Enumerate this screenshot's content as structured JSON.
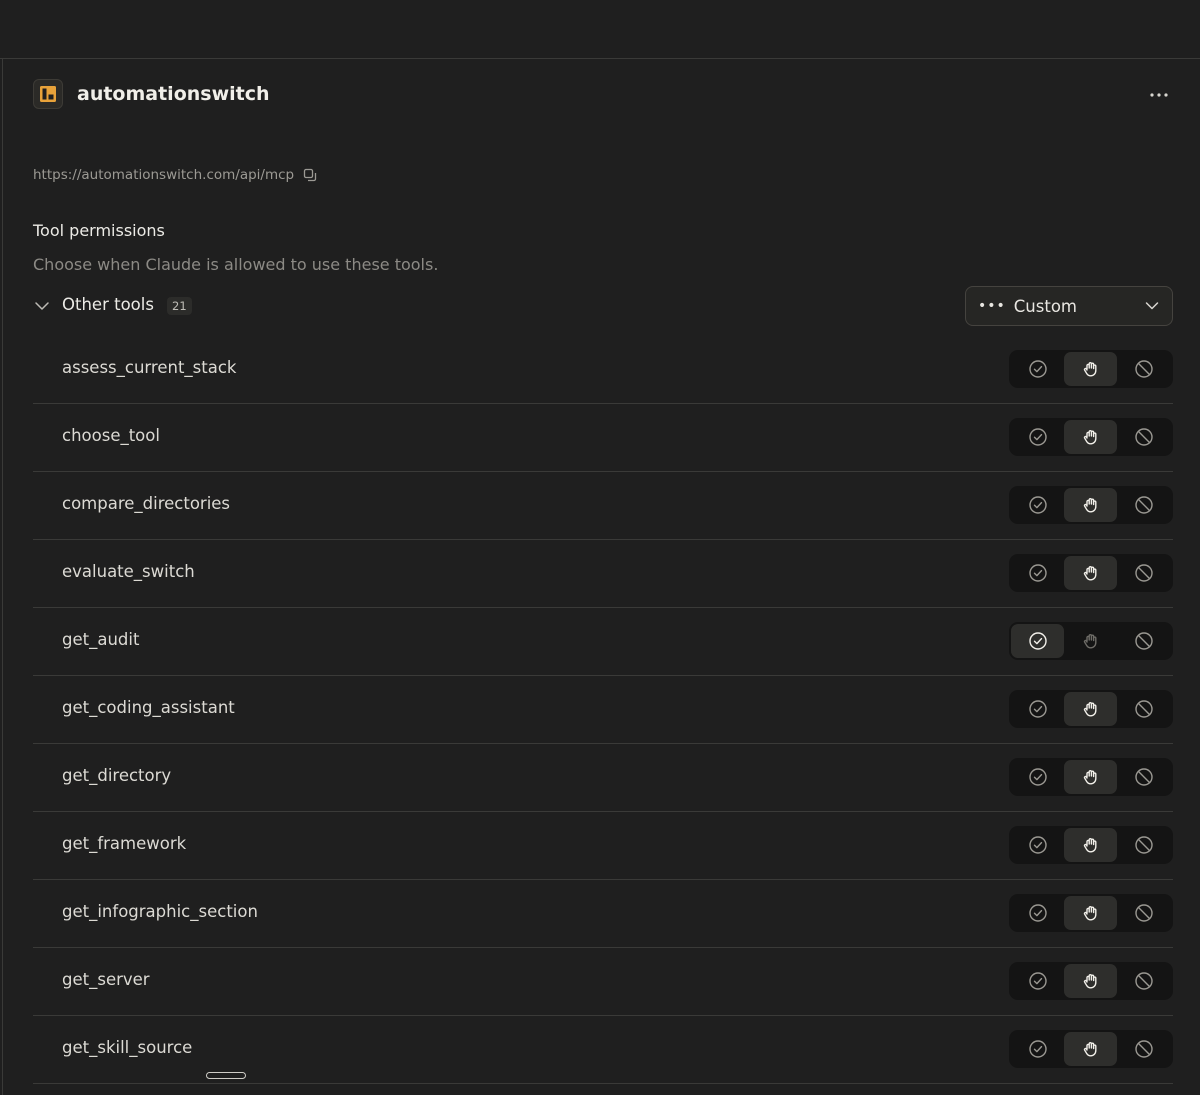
{
  "server": {
    "name": "automationswitch",
    "url": "https://automationswitch.com/api/mcp"
  },
  "permissions": {
    "title": "Tool permissions",
    "description": "Choose when Claude is allowed to use these tools."
  },
  "group": {
    "label": "Other tools",
    "count": "21",
    "mode_label": "Custom"
  },
  "tools": [
    {
      "name": "assess_current_stack",
      "permission": "needs-approval"
    },
    {
      "name": "choose_tool",
      "permission": "needs-approval"
    },
    {
      "name": "compare_directories",
      "permission": "needs-approval"
    },
    {
      "name": "evaluate_switch",
      "permission": "needs-approval"
    },
    {
      "name": "get_audit",
      "permission": "always-allow"
    },
    {
      "name": "get_coding_assistant",
      "permission": "needs-approval"
    },
    {
      "name": "get_directory",
      "permission": "needs-approval"
    },
    {
      "name": "get_framework",
      "permission": "needs-approval"
    },
    {
      "name": "get_infographic_section",
      "permission": "needs-approval"
    },
    {
      "name": "get_server",
      "permission": "needs-approval"
    },
    {
      "name": "get_skill_source",
      "permission": "needs-approval"
    }
  ],
  "icons": {
    "allow": "check-circle-icon",
    "approval": "hand-icon",
    "block": "block-icon"
  },
  "colors": {
    "background": "#1f1f1f",
    "logo_accent": "#e8a23a"
  }
}
